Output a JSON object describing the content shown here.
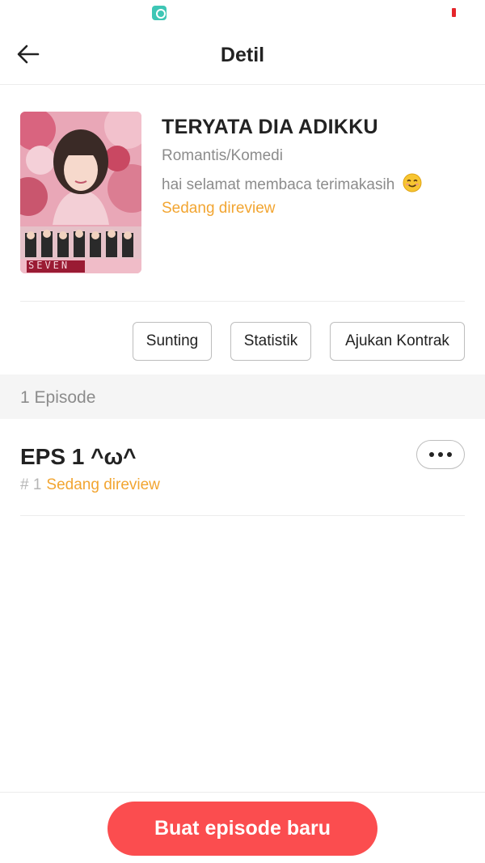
{
  "status_bar": {
    "app_icon": "chat-bubble-icon",
    "battery_icon": "battery-low-icon"
  },
  "header": {
    "back_icon": "arrow-left-icon",
    "title": "Detil"
  },
  "book": {
    "cover_text": "SEVEN",
    "title": "TERYATA DIA ADIKKU",
    "genre": "Romantis/Komedi",
    "description": "hai selamat membaca terimakasih",
    "description_emoji": "smiling-face-icon",
    "status": "Sedang direview"
  },
  "actions": {
    "edit_label": "Sunting",
    "stats_label": "Statistik",
    "contract_label": "Ajukan Kontrak"
  },
  "episodes": {
    "count_label": "1 Episode",
    "items": [
      {
        "title": "EPS 1 ^ω^",
        "number": "# 1",
        "status": "Sedang direview",
        "more_icon": "more-horizontal-icon"
      }
    ]
  },
  "bottom": {
    "create_label": "Buat episode baru"
  },
  "colors": {
    "accent": "#fb4d4f",
    "status": "#f2a531",
    "muted": "#8c8c8c"
  }
}
